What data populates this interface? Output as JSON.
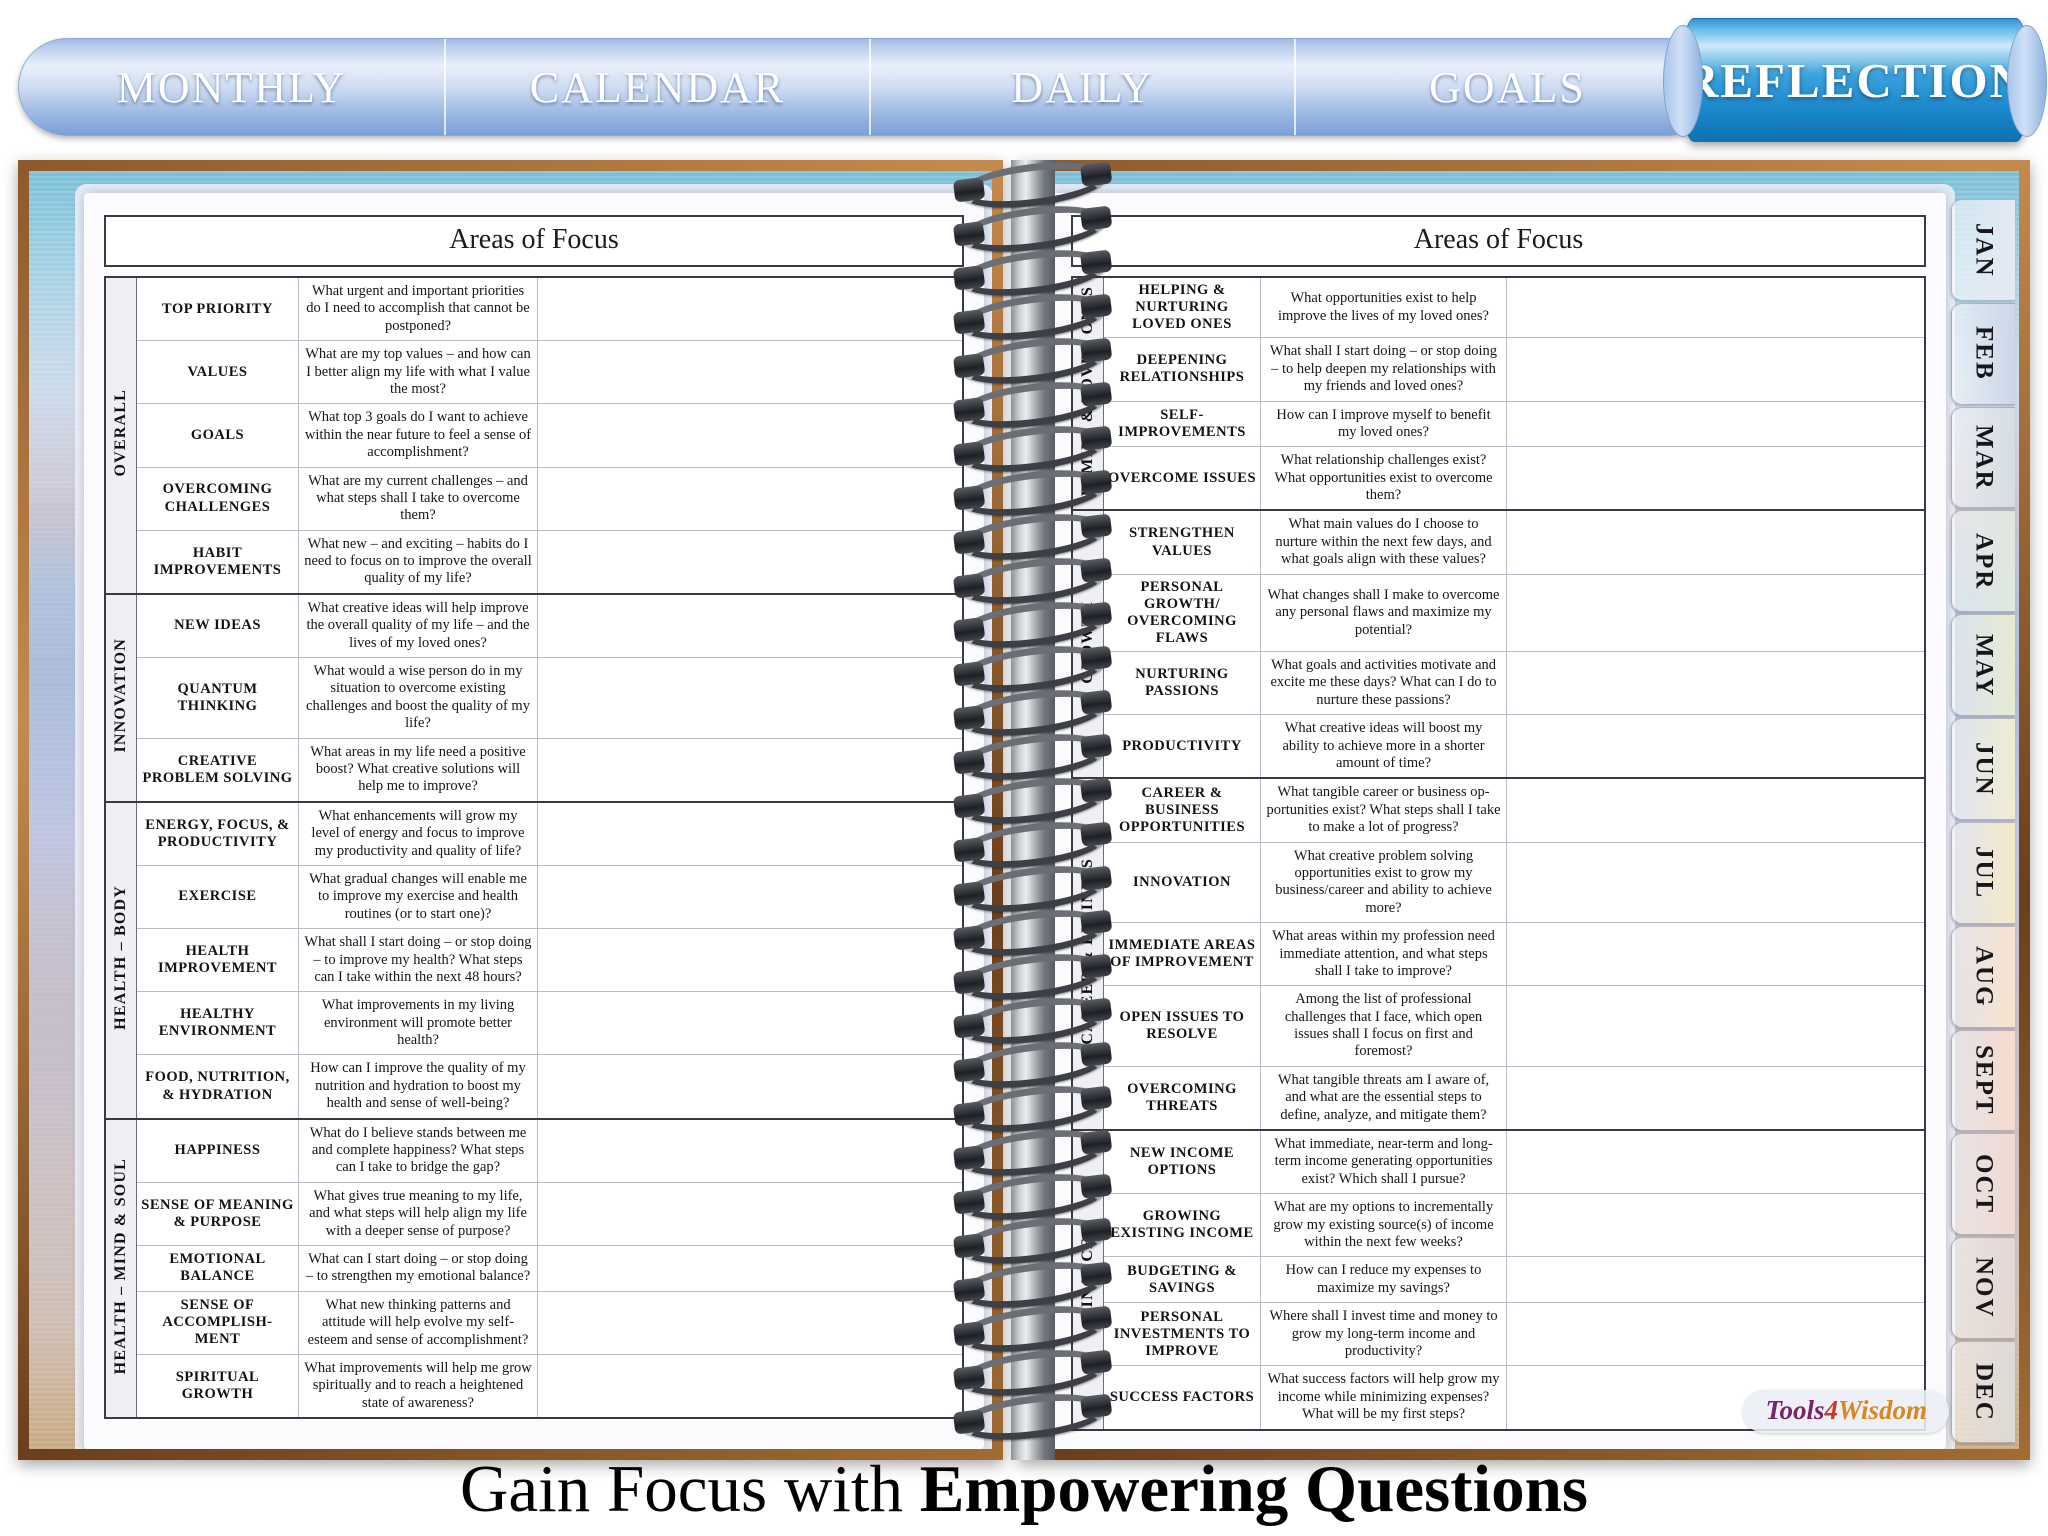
{
  "tabs": {
    "items": [
      {
        "label": "MONTHLY"
      },
      {
        "label": "CALENDAR"
      },
      {
        "label": "DAILY"
      },
      {
        "label": "GOALS"
      }
    ],
    "active": "REFLECTION"
  },
  "left_page": {
    "header": "Areas of Focus",
    "sections": [
      {
        "group": "OVERALL",
        "rows": [
          {
            "area": "TOP PRIORITY",
            "question": "What urgent and important priorities do I need to accomplish that cannot be postponed?",
            "answer": ""
          },
          {
            "area": "VALUES",
            "question": "What are my top values – and how can I better align my life with what I value the most?",
            "answer": ""
          },
          {
            "area": "GOALS",
            "question": "What top 3 goals do I want to achieve within the near future to feel a sense of accomplishment?",
            "answer": ""
          },
          {
            "area": "OVERCOMING CHALLENGES",
            "question": "What are my current challenges – and what steps shall I take to overcome them?",
            "answer": ""
          },
          {
            "area": "HABIT IMPROVEMENTS",
            "question": "What new – and exciting – habits do I need to focus on to improve the overall quality of my life?",
            "answer": ""
          }
        ]
      },
      {
        "group": "INNOVATION",
        "rows": [
          {
            "area": "NEW IDEAS",
            "question": "What creative ideas will help improve the overall quality of my life – and the lives of my loved ones?",
            "answer": ""
          },
          {
            "area": "QUANTUM THINKING",
            "question": "What would a wise person do in my situation to overcome existing challenges and boost the quality of my life?",
            "answer": ""
          },
          {
            "area": "CREATIVE PROBLEM SOLVING",
            "question": "What areas in my life need a positive boost? What creative solutions will help me to improve?",
            "answer": ""
          }
        ]
      },
      {
        "group": "HEALTH – BODY",
        "rows": [
          {
            "area": "ENERGY, FOCUS, & PRODUCTIVITY",
            "question": "What enhancements will grow my level of energy and focus to improve my productivity and quality of life?",
            "answer": ""
          },
          {
            "area": "EXERCISE",
            "question": "What gradual changes will enable me to improve my exercise and health routines (or to start one)?",
            "answer": ""
          },
          {
            "area": "HEALTH IMPROVEMENT",
            "question": "What shall I start doing – or stop doing – to improve my health? What steps can I take within the next 48 hours?",
            "answer": ""
          },
          {
            "area": "HEALTHY ENVIRONMENT",
            "question": "What improvements in my living environment will promote better health?",
            "answer": ""
          },
          {
            "area": "FOOD, NUTRITION, & HYDRATION",
            "question": "How can I improve the quality of my nutrition and hydration to boost my health and sense of well-being?",
            "answer": ""
          }
        ]
      },
      {
        "group": "HEALTH – MIND & SOUL",
        "rows": [
          {
            "area": "HAPPINESS",
            "question": "What do I believe stands between me and complete happiness? What steps can I take to bridge the gap?",
            "answer": ""
          },
          {
            "area": "SENSE OF MEANING & PURPOSE",
            "question": "What gives true meaning to my life, and what steps will help align my life with a deeper sense of purpose?",
            "answer": ""
          },
          {
            "area": "EMOTIONAL BALANCE",
            "question": "What can I start doing – or stop doing – to strengthen my emotional balance?",
            "answer": ""
          },
          {
            "area": "SENSE OF ACCOMPLISH-MENT",
            "question": "What new thinking patterns and attitude will help evolve my self-esteem and sense of accomplishment?",
            "answer": ""
          },
          {
            "area": "SPIRITUAL GROWTH",
            "question": "What improvements will help me grow spiritually and to reach a heightened state of awareness?",
            "answer": ""
          }
        ]
      }
    ]
  },
  "right_page": {
    "header": "Areas of Focus",
    "sections": [
      {
        "group": "FAMILY & LOVED ONES",
        "rows": [
          {
            "area": "HELPING & NURTURING LOVED ONES",
            "question": "What opportunities exist to help improve the lives of my loved ones?",
            "answer": ""
          },
          {
            "area": "DEEPENING RELATIONSHIPS",
            "question": "What shall I start doing – or stop doing – to help deepen my relationships with my friends and loved ones?",
            "answer": ""
          },
          {
            "area": "SELF-IMPROVEMENTS",
            "question": "How can I improve myself to benefit my loved ones?",
            "answer": ""
          },
          {
            "area": "OVERCOME ISSUES",
            "question": "What relationship challenges exist? What opportunities exist to overcome them?",
            "answer": ""
          }
        ]
      },
      {
        "group": "GROWTH",
        "rows": [
          {
            "area": "STRENGTHEN VALUES",
            "question": "What main values do I choose to nurture within the next few days, and what goals align with these values?",
            "answer": ""
          },
          {
            "area": "PERSONAL GROWTH/ OVERCOMING FLAWS",
            "question": "What changes shall I make to overcome any personal flaws and maximize my potential?",
            "answer": ""
          },
          {
            "area": "NURTURING PASSIONS",
            "question": "What goals and activities motivate and excite me these days? What can I do to nurture these passions?",
            "answer": ""
          },
          {
            "area": "PRODUCTIVITY",
            "question": "What creative ideas will boost my ability to achieve more in a shorter amount of time?",
            "answer": ""
          }
        ]
      },
      {
        "group": "CAREER & BUSINESS",
        "rows": [
          {
            "area": "CAREER & BUSINESS OPPORTUNITIES",
            "question": "What tangible career or business op-portunities exist? What steps shall I take to make a lot of progress?",
            "answer": ""
          },
          {
            "area": "INNOVATION",
            "question": "What creative problem solving opportunities exist to grow my business/career and ability to achieve more?",
            "answer": ""
          },
          {
            "area": "IMMEDIATE AREAS OF IMPROVEMENT",
            "question": "What areas within my profession need immediate attention, and what steps shall I take to improve?",
            "answer": ""
          },
          {
            "area": "OPEN ISSUES TO RESOLVE",
            "question": "Among the list of professional challenges that I face, which open issues shall I focus on first and foremost?",
            "answer": ""
          },
          {
            "area": "OVERCOMING THREATS",
            "question": "What tangible threats am I aware of, and what are the essential steps to define, analyze, and mitigate them?",
            "answer": ""
          }
        ]
      },
      {
        "group": "FINANCE",
        "rows": [
          {
            "area": "NEW INCOME OPTIONS",
            "question": "What immediate, near-term and long-term income generating opportunities exist? Which shall I pursue?",
            "answer": ""
          },
          {
            "area": "GROWING EXISTING INCOME",
            "question": "What are my options to incrementally grow my existing source(s) of income within the next few weeks?",
            "answer": ""
          },
          {
            "area": "BUDGETING & SAVINGS",
            "question": "How can I reduce my expenses to maximize my savings?",
            "answer": ""
          },
          {
            "area": "PERSONAL INVESTMENTS TO IMPROVE",
            "question": "Where shall I invest time and money to grow my long-term income and productivity?",
            "answer": ""
          },
          {
            "area": "SUCCESS FACTORS",
            "question": "What success factors will help grow my income while minimizing expenses? What will be my first steps?",
            "answer": ""
          }
        ]
      }
    ]
  },
  "month_tabs": [
    {
      "label": "JAN",
      "color": "#e4e9f2"
    },
    {
      "label": "FEB",
      "color": "#ccd6e8"
    },
    {
      "label": "MAR",
      "color": "#d6dde2"
    },
    {
      "label": "APR",
      "color": "#dfe7de"
    },
    {
      "label": "MAY",
      "color": "#e6ead2"
    },
    {
      "label": "JUN",
      "color": "#f0ecd2"
    },
    {
      "label": "JUL",
      "color": "#f3e9c8"
    },
    {
      "label": "AUG",
      "color": "#f7e3cf"
    },
    {
      "label": "SEPT",
      "color": "#f4dbcd"
    },
    {
      "label": "OCT",
      "color": "#f0d9d2"
    },
    {
      "label": "NOV",
      "color": "#e2d7d3"
    },
    {
      "label": "DEC",
      "color": "#ded9d6"
    }
  ],
  "logo": {
    "part1": "Tools",
    "part2": "4",
    "part3": "Wisdom"
  },
  "caption": {
    "light": "Gain Focus with ",
    "bold": "Empowering Questions"
  }
}
